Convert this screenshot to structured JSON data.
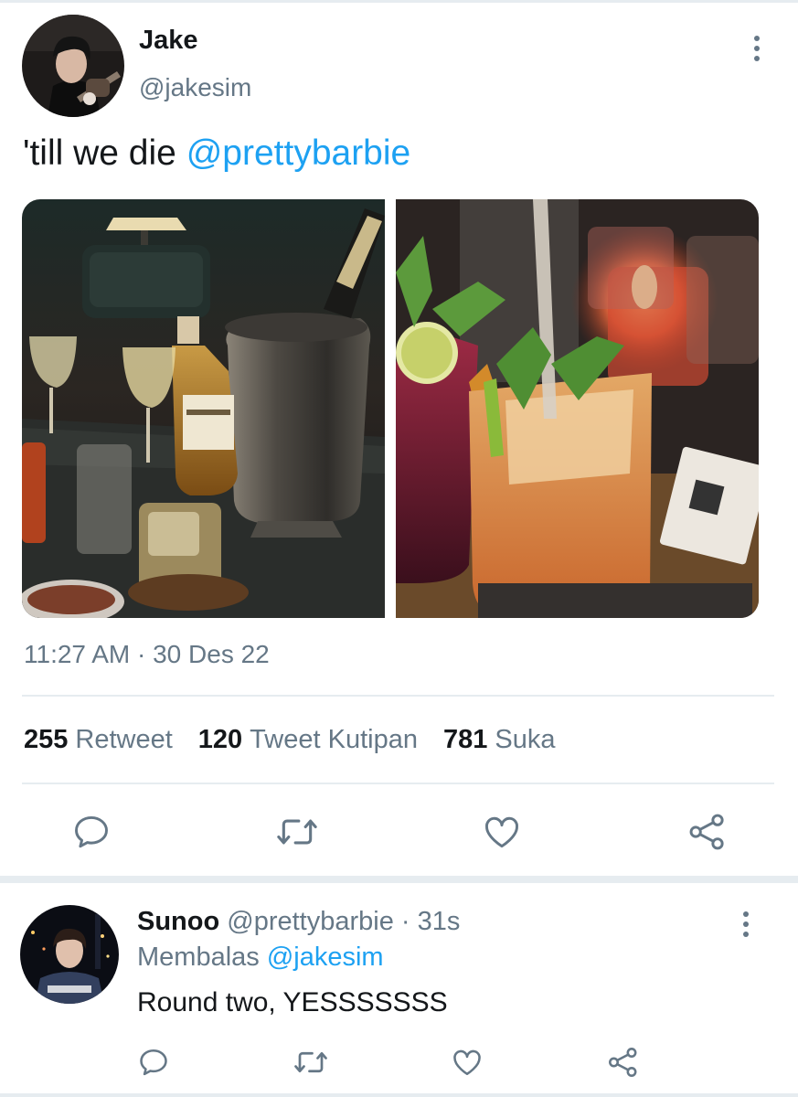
{
  "tweet": {
    "author_name": "Jake",
    "author_handle": "@jakesim",
    "text_plain": "'till we die ",
    "text_mention": "@prettybarbie",
    "timestamp": "11:27 AM · 30 Des 22",
    "stats": {
      "retweets_count": "255",
      "retweets_label": "Retweet",
      "quotes_count": "120",
      "quotes_label": "Tweet Kutipan",
      "likes_count": "781",
      "likes_label": "Suka"
    },
    "media": [
      "bar-table-drinks-photo",
      "cocktail-candles-photo"
    ],
    "actions": [
      "reply-icon",
      "retweet-icon",
      "like-icon",
      "share-icon"
    ]
  },
  "reply": {
    "author_name": "Sunoo",
    "author_handle": "@prettybarbie",
    "time": "· 31s",
    "replying_label": "Membalas",
    "replying_to": "@jakesim",
    "text": "Round two, YESSSSSSS",
    "actions": [
      "reply-icon",
      "retweet-icon",
      "like-icon",
      "share-icon"
    ]
  },
  "colors": {
    "link": "#1da1f2",
    "secondary_text": "#657786",
    "primary_text": "#14171a",
    "divider": "#e6ecf0"
  }
}
